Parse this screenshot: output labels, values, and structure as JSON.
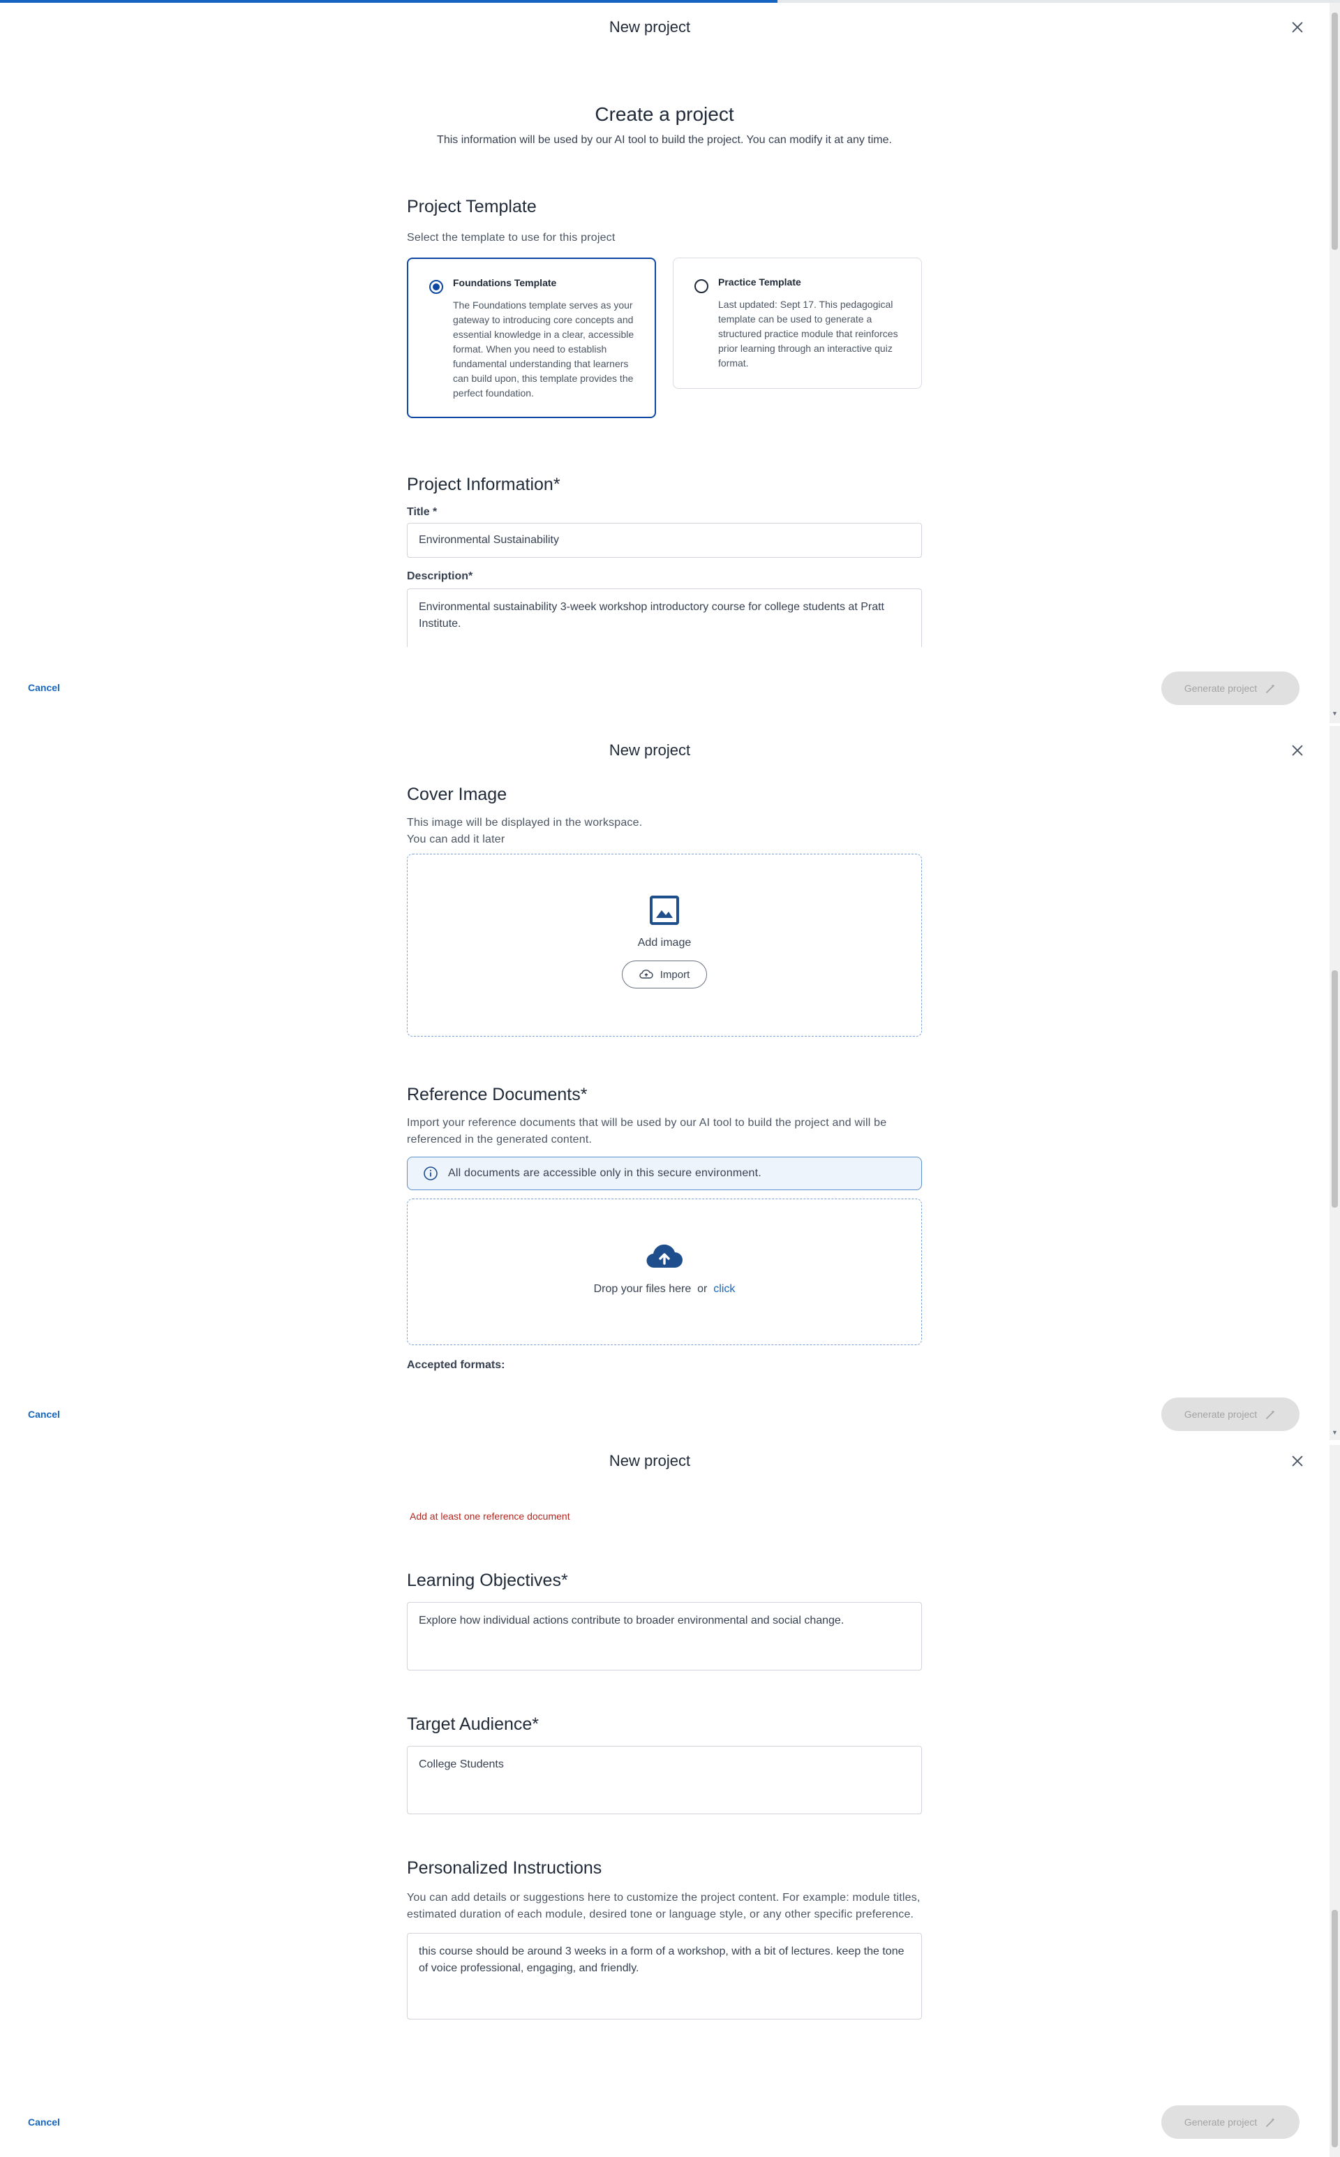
{
  "progress": {
    "value": 0.58,
    "color": "#1565c0"
  },
  "modal": {
    "title": "New project",
    "close_icon": "close-icon",
    "cancel_label": "Cancel",
    "generate_label": "Generate project",
    "generate_icon": "magic-wand-icon"
  },
  "intro": {
    "heading": "Create a project",
    "subheading": "This information will be used by our AI tool to build the project. You can modify it at any time."
  },
  "template_section": {
    "title": "Project Template",
    "description": "Select the template to use for this project",
    "options": [
      {
        "name": "Foundations Template",
        "selected": true,
        "description": "The Foundations template serves as your gateway to introducing core concepts and essential knowledge in a clear, accessible format. When you need to establish fundamental understanding that learners can build upon, this template provides the perfect foundation."
      },
      {
        "name": "Practice Template",
        "selected": false,
        "description": "Last updated: Sept 17. This pedagogical template can be used to generate a structured practice module that reinforces prior learning through an interactive quiz format."
      }
    ]
  },
  "project_info": {
    "title": "Project Information*",
    "title_label": "Title *",
    "title_value": "Environmental Sustainability",
    "description_label": "Description*",
    "description_value": "Environmental sustainability 3-week workshop introductory course for college students at Pratt Institute."
  },
  "cover_image": {
    "title": "Cover Image",
    "description_line1": "This image will be displayed in the workspace.",
    "description_line2": "You can add it later",
    "add_label": "Add image",
    "add_icon": "image-icon",
    "import_label": "Import",
    "import_icon": "cloud-upload-icon"
  },
  "reference_docs": {
    "title": "Reference Documents*",
    "description": "Import your reference documents that will be used by our AI tool to build the project and will be referenced in the generated content.",
    "info_text": "All documents are accessible only in this secure environment.",
    "info_icon": "info-icon",
    "drop_text": "Drop your files here",
    "or_text": "or",
    "click_text": "click",
    "upload_icon": "cloud-upload-icon",
    "accepted_formats_label": "Accepted formats:",
    "error_text": "Add at least one reference document"
  },
  "learning_objectives": {
    "title": "Learning Objectives*",
    "value": "Explore how individual actions contribute to broader environmental and social change."
  },
  "target_audience": {
    "title": "Target Audience*",
    "value": "College Students"
  },
  "personalized": {
    "title": "Personalized Instructions",
    "description": "You can add details or suggestions here to customize the project content. For example: module titles, estimated duration of each module, desired tone or language style, or any other specific preference.",
    "value": "this course should be around 3 weeks in a form of a workshop, with a bit of lectures. keep the tone of voice professional, engaging, and friendly."
  },
  "colors": {
    "accent": "#1565c0",
    "selected_border": "#0d47a1",
    "error": "#b3261e",
    "disabled_bg": "#e0e0e0"
  }
}
